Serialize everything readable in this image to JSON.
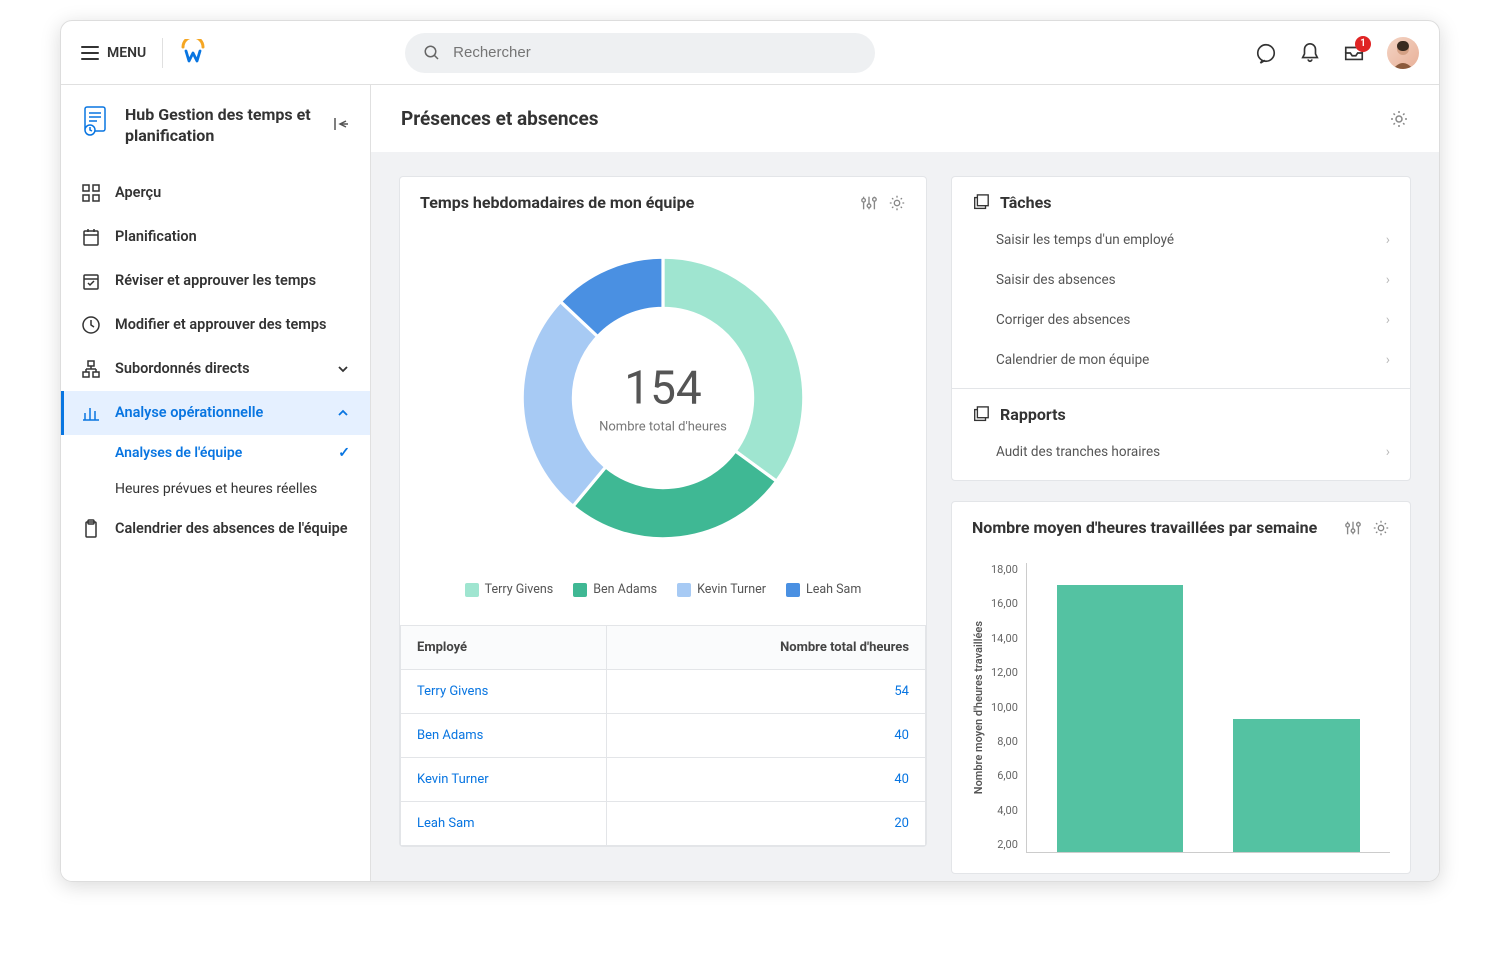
{
  "header": {
    "menu_label": "MENU",
    "search_placeholder": "Rechercher",
    "inbox_badge": "1"
  },
  "sidebar": {
    "title": "Hub Gestion des temps et planification",
    "items": [
      {
        "label": "Aperçu",
        "icon": "grid"
      },
      {
        "label": "Planification",
        "icon": "calendar"
      },
      {
        "label": "Réviser et approuver les temps",
        "icon": "calendar-check"
      },
      {
        "label": "Modifier et approuver des temps",
        "icon": "clock"
      },
      {
        "label": "Subordonnés directs",
        "icon": "org",
        "expandable": true,
        "expanded": false
      },
      {
        "label": "Analyse opérationnelle",
        "icon": "bars",
        "expandable": true,
        "expanded": true,
        "active": true,
        "children": [
          {
            "label": "Analyses de l'équipe",
            "active": true
          },
          {
            "label": "Heures prévues et heures réelles"
          }
        ]
      },
      {
        "label": "Calendrier des absences de l'équipe",
        "icon": "clipboard"
      }
    ]
  },
  "page": {
    "title": "Présences et absences"
  },
  "donut_card": {
    "title": "Temps hebdomadaires de mon équipe",
    "center_value": "154",
    "center_label": "Nombre total d'heures",
    "table_headers": {
      "employee": "Employé",
      "hours": "Nombre total d'heures"
    },
    "rows": [
      {
        "name": "Terry Givens",
        "hours": "54"
      },
      {
        "name": "Ben Adams",
        "hours": "40"
      },
      {
        "name": "Kevin Turner",
        "hours": "40"
      },
      {
        "name": "Leah Sam",
        "hours": "20"
      }
    ],
    "legend": [
      {
        "label": "Terry Givens",
        "color": "#9fe5d0"
      },
      {
        "label": "Ben Adams",
        "color": "#3fb894"
      },
      {
        "label": "Kevin Turner",
        "color": "#a7caf4"
      },
      {
        "label": "Leah Sam",
        "color": "#4a90e2"
      }
    ]
  },
  "tasks_card": {
    "tasks_title": "Tâches",
    "tasks": [
      "Saisir les temps d'un employé",
      "Saisir des absences",
      "Corriger des absences",
      "Calendrier de mon équipe"
    ],
    "reports_title": "Rapports",
    "reports": [
      "Audit des tranches horaires"
    ]
  },
  "bar_card": {
    "title": "Nombre moyen d'heures travaillées par semaine",
    "ylabel": "Nombre moyen d'heures travaillées",
    "yticks": [
      "18,00",
      "16,00",
      "14,00",
      "12,00",
      "10,00",
      "8,00",
      "6,00",
      "4,00",
      "2,00"
    ]
  },
  "chart_data": [
    {
      "type": "donut",
      "title": "Temps hebdomadaires de mon équipe",
      "center_value": 154,
      "center_label": "Nombre total d'heures",
      "series": [
        {
          "name": "Terry Givens",
          "value": 54,
          "color": "#9fe5d0"
        },
        {
          "name": "Ben Adams",
          "value": 40,
          "color": "#3fb894"
        },
        {
          "name": "Kevin Turner",
          "value": 40,
          "color": "#a7caf4"
        },
        {
          "name": "Leah Sam",
          "value": 20,
          "color": "#4a90e2"
        }
      ]
    },
    {
      "type": "bar",
      "title": "Nombre moyen d'heures travaillées par semaine",
      "ylabel": "Nombre moyen d'heures travaillées",
      "ylim": [
        0,
        18
      ],
      "values": [
        16.6,
        8.3
      ],
      "color": "#54c2a2"
    }
  ]
}
